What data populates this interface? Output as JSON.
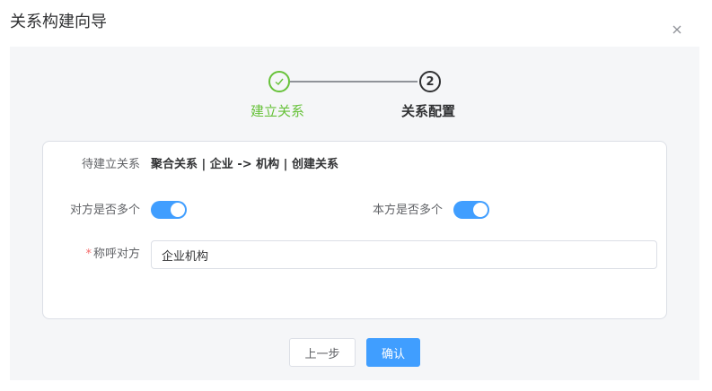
{
  "dialog": {
    "title": "关系构建向导",
    "close_icon": "close-icon"
  },
  "steps": [
    {
      "number": "1",
      "label": "建立关系",
      "status": "finished",
      "icon": "check-icon"
    },
    {
      "number": "2",
      "label": "关系配置",
      "status": "active"
    }
  ],
  "colors": {
    "finished": "#67c23a",
    "active": "#303133",
    "primary": "#409eff",
    "required": "#f56c6c"
  },
  "form": {
    "pending_label": "待建立关系",
    "pending_value": "聚合关系 | 企业 -> 机构 | 创建关系",
    "other_many_label": "对方是否多个",
    "other_many_value": true,
    "self_many_label": "本方是否多个",
    "self_many_value": true,
    "required_mark": "*",
    "alias_label": "称呼对方",
    "alias_value": "企业机构"
  },
  "footer": {
    "prev_label": "上一步",
    "confirm_label": "确认"
  }
}
